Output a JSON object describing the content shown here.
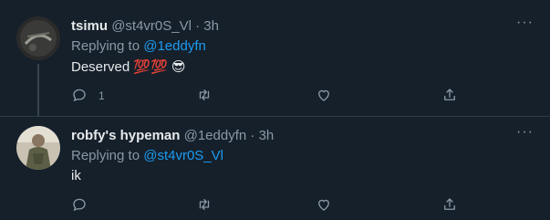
{
  "tweets": [
    {
      "name": "tsimu",
      "handle": "@st4vr0S_Vl",
      "dot": "·",
      "time": "3h",
      "replying_prefix": "Replying to ",
      "replying_to": "@1eddyfn",
      "text": "Deserved",
      "emojis": [
        "💯",
        "💯",
        "😎"
      ],
      "reply_count": "1",
      "more": "···"
    },
    {
      "name": "robfy's hypeman",
      "handle": "@1eddyfn",
      "dot": "·",
      "time": "3h",
      "replying_prefix": "Replying to ",
      "replying_to": "@st4vr0S_Vl",
      "text": "ik",
      "more": "···"
    }
  ],
  "colors": {
    "background": "#15202b",
    "accent": "#1d9bf0",
    "muted": "#8b98a5",
    "text": "#e7e9ea"
  },
  "icons": [
    "reply-icon",
    "retweet-icon",
    "like-icon",
    "share-icon",
    "more-icon"
  ]
}
